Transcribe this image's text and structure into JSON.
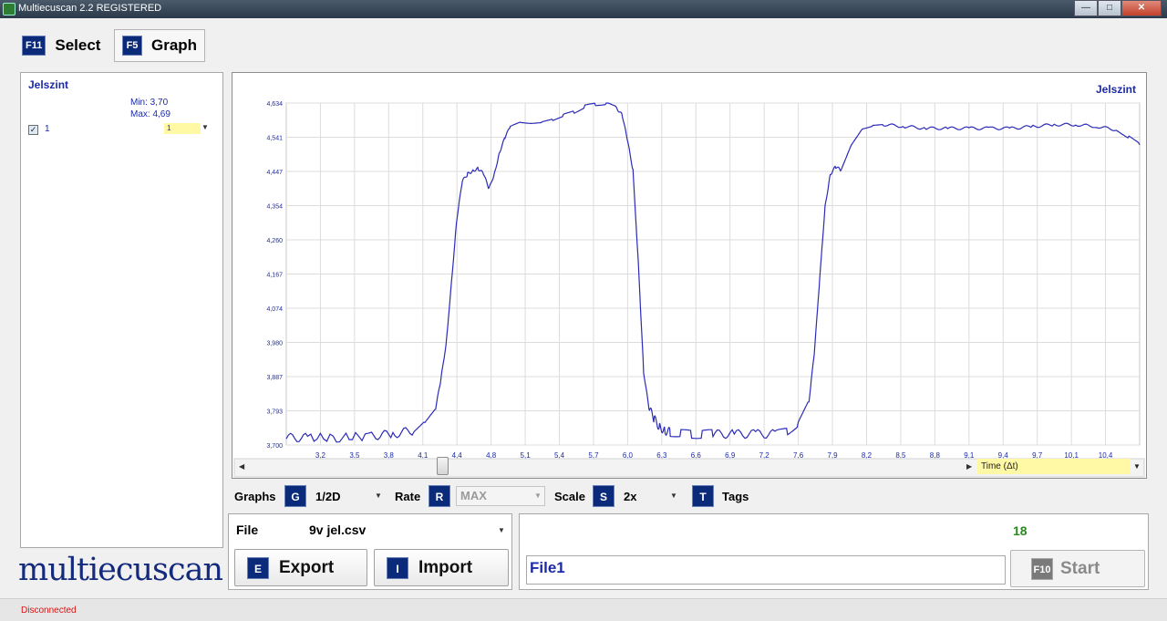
{
  "window": {
    "title": "Multiecuscan 2.2 REGISTERED"
  },
  "tabs": [
    {
      "key": "F11",
      "label": "Select"
    },
    {
      "key": "F5",
      "label": "Graph"
    }
  ],
  "left_panel": {
    "title": "Jelszint",
    "min": "Min: 3,70",
    "max": "Max: 4,69",
    "channel_label": "1",
    "channel_select": "1"
  },
  "logo": "multiecuscan",
  "graph": {
    "scroll_select": "Time (Δt)"
  },
  "controls": {
    "graphs_label": "Graphs",
    "graphs_key": "G",
    "graphs_value": "1/2D",
    "rate_label": "Rate",
    "rate_key": "R",
    "rate_value": "MAX",
    "scale_label": "Scale",
    "scale_key": "S",
    "scale_value": "2x",
    "tags_label": "Tags",
    "tags_key": "T"
  },
  "file_panel": {
    "label": "File",
    "value": "9v jel.csv",
    "export_key": "E",
    "export_label": "Export",
    "import_key": "I",
    "import_label": "Import"
  },
  "right_panel": {
    "count": "18",
    "file_name": "File1",
    "start_key": "F10",
    "start_label": "Start"
  },
  "status": {
    "text": "Disconnected"
  },
  "colors": {
    "accent": "#0b2a7a",
    "line": "#2b2bb8",
    "status": "#dd1111",
    "count": "#2b8a1f"
  },
  "chart_data": {
    "type": "line",
    "title": "Jelszint",
    "xlabel": "",
    "ylabel": "",
    "xlim": [
      3.0,
      11.0
    ],
    "ylim": [
      3.7,
      4.634
    ],
    "x_ticks": [
      "3,2",
      "3,5",
      "3,8",
      "4,1",
      "4,4",
      "4,8",
      "5,1",
      "5,4",
      "5,7",
      "6,0",
      "6,3",
      "6,6",
      "6,9",
      "7,2",
      "7,6",
      "7,9",
      "8,2",
      "8,5",
      "8,8",
      "9,1",
      "9,4",
      "9,7",
      "10,1",
      "10,4"
    ],
    "y_ticks": [
      "4,634",
      "4,541",
      "4,447",
      "4,354",
      "4,260",
      "4,167",
      "4,074",
      "3,980",
      "3,887",
      "3,793",
      "3,700"
    ],
    "grid": true,
    "series": [
      {
        "name": "1",
        "x": [
          3.0,
          3.2,
          3.5,
          3.8,
          4.0,
          4.2,
          4.3,
          4.4,
          4.45,
          4.5,
          4.55,
          4.6,
          4.65,
          4.7,
          4.75,
          4.8,
          4.85,
          4.9,
          4.95,
          5.0,
          5.05,
          5.1,
          5.2,
          5.3,
          5.4,
          5.5,
          5.6,
          5.7,
          5.8,
          5.9,
          6.0,
          6.1,
          6.15,
          6.2,
          6.25,
          6.3,
          6.35,
          6.4,
          6.45,
          6.5,
          6.55,
          6.6,
          6.7,
          6.8,
          6.9,
          7.0,
          7.2,
          7.4,
          7.6,
          7.7,
          7.8,
          7.9,
          7.95,
          8.0,
          8.05,
          8.1,
          8.15,
          8.2,
          8.3,
          8.4,
          8.5,
          8.6,
          8.8,
          9.0,
          9.2,
          9.4,
          9.6,
          9.8,
          10.0,
          10.2,
          10.4,
          10.6,
          10.8,
          10.9,
          11.0
        ],
        "y": [
          3.72,
          3.72,
          3.72,
          3.725,
          3.73,
          3.74,
          3.76,
          3.8,
          3.88,
          3.98,
          4.15,
          4.32,
          4.42,
          4.44,
          4.45,
          4.455,
          4.44,
          4.4,
          4.44,
          4.5,
          4.54,
          4.57,
          4.58,
          4.58,
          4.58,
          4.59,
          4.6,
          4.61,
          4.625,
          4.63,
          4.634,
          4.62,
          4.6,
          4.53,
          4.45,
          4.2,
          3.9,
          3.8,
          3.77,
          3.75,
          3.74,
          3.735,
          3.73,
          3.73,
          3.73,
          3.73,
          3.73,
          3.73,
          3.73,
          3.74,
          3.76,
          3.82,
          3.95,
          4.15,
          4.35,
          4.44,
          4.46,
          4.45,
          4.52,
          4.565,
          4.57,
          4.575,
          4.57,
          4.565,
          4.565,
          4.565,
          4.565,
          4.565,
          4.57,
          4.575,
          4.575,
          4.57,
          4.56,
          4.54,
          4.52
        ]
      }
    ]
  }
}
